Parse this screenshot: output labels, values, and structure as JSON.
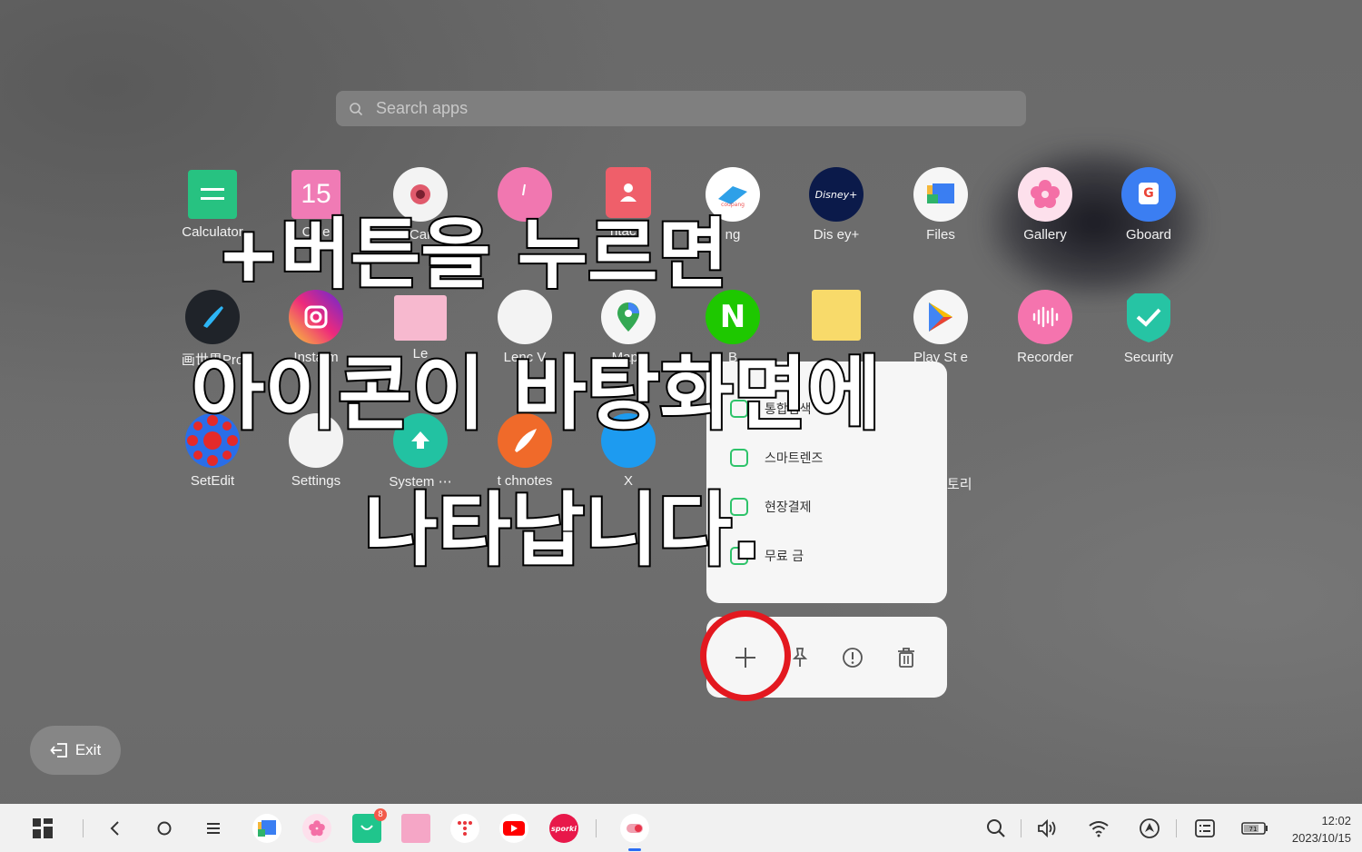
{
  "search": {
    "placeholder": "Search apps"
  },
  "apps_row1": [
    "Calculator",
    "Cale",
    "Car",
    "",
    "ntacts",
    "ng",
    "Dis ey+",
    "Files",
    "Gallery",
    "Gboard"
  ],
  "apps_row2": [
    "画世界Pro",
    "Insta  m",
    "Le  ",
    "Lenc  V",
    "Maps",
    "B",
    "",
    "Play St  e",
    "Recorder",
    "Security"
  ],
  "apps_row3": [
    "SetEdit",
    "Settings",
    "System ⋯",
    "t  chnotes",
    "X",
    "",
    "",
    "",
    "",
    ""
  ],
  "context_menu": {
    "items": [
      "통합검색",
      "스마트렌즈",
      "현장결제",
      "무료  금"
    ],
    "partial_label": "토리"
  },
  "calendar_date": "15",
  "caption": {
    "line1": "+버튼을 누르면",
    "line2": "아이콘이 바탕화면에",
    "line3": "나타납니다."
  },
  "exit_label": "Exit",
  "taskbar": {
    "time": "12:02",
    "date": "2023/10/15",
    "battery": "71",
    "badge": "8",
    "sporki": "sporki"
  },
  "colors": {
    "accent_red": "#e3181f",
    "naver_green": "#2ec36a"
  }
}
